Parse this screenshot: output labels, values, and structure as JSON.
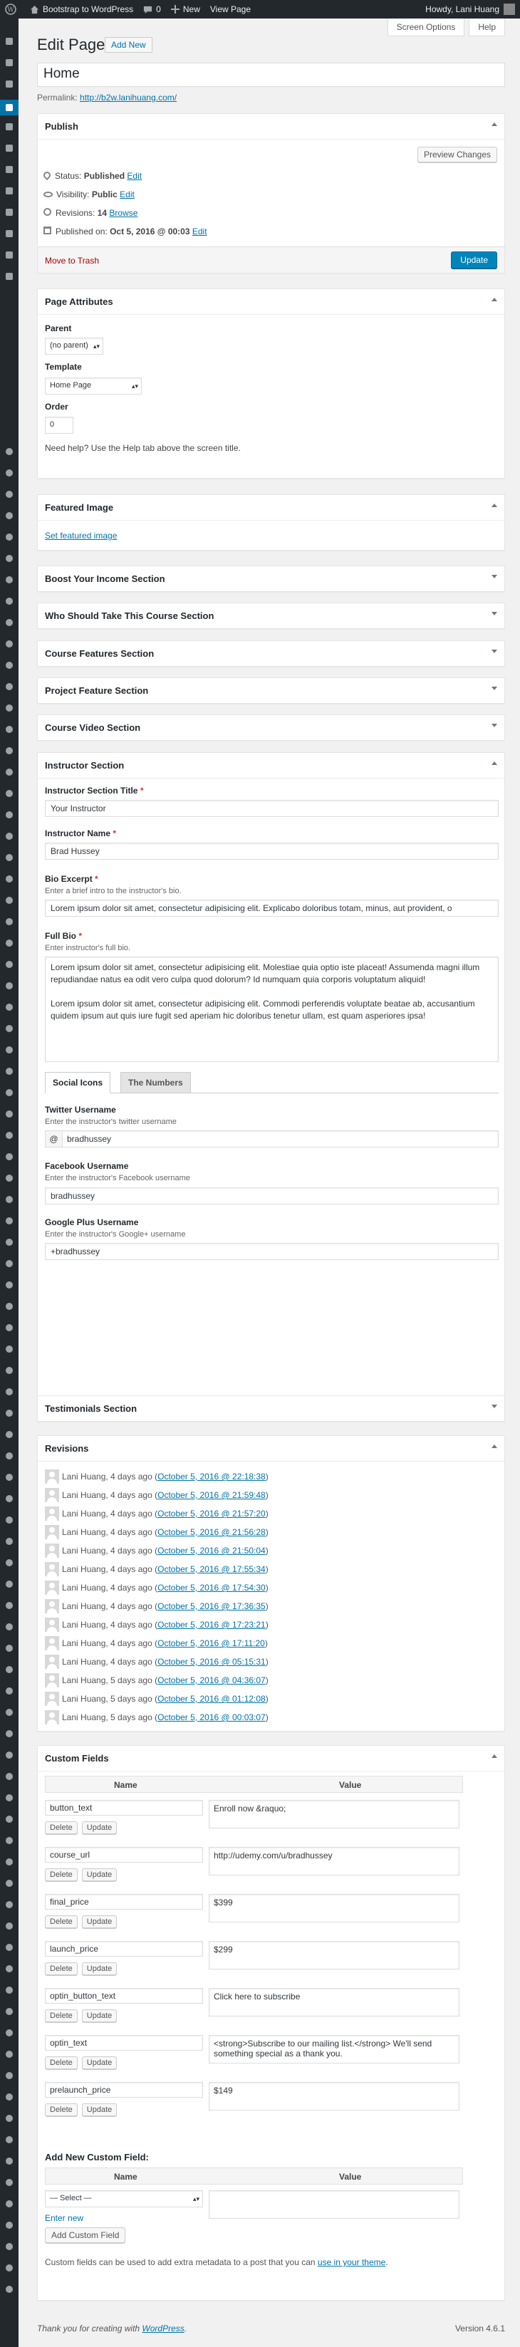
{
  "adminbar": {
    "site": "Bootstrap to WordPress",
    "comments": "0",
    "new": "New",
    "view": "View Page",
    "howdy": "Howdy, Lani Huang"
  },
  "header": {
    "screen_options": "Screen Options",
    "help": "Help",
    "title": "Edit Page",
    "add_new": "Add New"
  },
  "post": {
    "title": "Home",
    "permalink_label": "Permalink:",
    "permalink_url": "http://b2w.lanihuang.com/"
  },
  "publish": {
    "title": "Publish",
    "preview": "Preview Changes",
    "status_label": "Status:",
    "status": "Published",
    "visibility_label": "Visibility:",
    "visibility": "Public",
    "revisions_label": "Revisions:",
    "revisions": "14",
    "browse": "Browse",
    "published_label": "Published on:",
    "published": "Oct 5, 2016 @ 00:03",
    "edit": "Edit",
    "trash": "Move to Trash",
    "update": "Update"
  },
  "attributes": {
    "title": "Page Attributes",
    "parent_label": "Parent",
    "parent": "(no parent)",
    "template_label": "Template",
    "template": "Home Page",
    "order_label": "Order",
    "order": "0",
    "help": "Need help? Use the Help tab above the screen title."
  },
  "featured": {
    "title": "Featured Image",
    "link": "Set featured image"
  },
  "sections": {
    "income": "Boost Your Income Section",
    "who": "Who Should Take This Course Section",
    "features": "Course Features Section",
    "project": "Project Feature Section",
    "video": "Course Video Section",
    "instructor": "Instructor Section",
    "testimonials": "Testimonials Section"
  },
  "instructor": {
    "title_label": "Instructor Section Title",
    "title_value": "Your Instructor",
    "name_label": "Instructor Name",
    "name_value": "Brad Hussey",
    "excerpt_label": "Bio Excerpt",
    "excerpt_desc": "Enter a brief intro to the instructor's bio.",
    "excerpt_value": "Lorem ipsum dolor sit amet, consectetur adipisicing elit. Explicabo doloribus totam, minus, aut provident, o",
    "bio_label": "Full Bio",
    "bio_desc": "Enter instructor's full bio.",
    "bio_p1": "Lorem ipsum dolor sit amet, consectetur adipisicing elit. Molestiae quia optio iste placeat! Assumenda magni illum repudiandae natus ea odit vero culpa quod dolorum? Id numquam quia corporis voluptatum aliquid!",
    "bio_p2": "Lorem ipsum dolor sit amet, consectetur adipisicing elit. Commodi perferendis voluptate beatae ab, accusantium quidem ipsum aut quis iure fugit sed aperiam hic doloribus tenetur ullam, est quam asperiores ipsa!",
    "tab_social": "Social Icons",
    "tab_numbers": "The Numbers",
    "twitter_label": "Twitter Username",
    "twitter_desc": "Enter the instructor's twitter username",
    "twitter_prefix": "@",
    "twitter": "bradhussey",
    "facebook_label": "Facebook Username",
    "facebook_desc": "Enter the instructor's Facebook username",
    "facebook": "bradhussey",
    "google_label": "Google Plus Username",
    "google_desc": "Enter the instructor's Google+ username",
    "google": "+bradhussey"
  },
  "revisions": {
    "title": "Revisions",
    "items": [
      {
        "author": "Lani Huang, 4 days ago",
        "date": "October 5, 2016 @ 22:18:38"
      },
      {
        "author": "Lani Huang, 4 days ago",
        "date": "October 5, 2016 @ 21:59:48"
      },
      {
        "author": "Lani Huang, 4 days ago",
        "date": "October 5, 2016 @ 21:57:20"
      },
      {
        "author": "Lani Huang, 4 days ago",
        "date": "October 5, 2016 @ 21:56:28"
      },
      {
        "author": "Lani Huang, 4 days ago",
        "date": "October 5, 2016 @ 21:50:04"
      },
      {
        "author": "Lani Huang, 4 days ago",
        "date": "October 5, 2016 @ 17:55:34"
      },
      {
        "author": "Lani Huang, 4 days ago",
        "date": "October 5, 2016 @ 17:54:30"
      },
      {
        "author": "Lani Huang, 4 days ago",
        "date": "October 5, 2016 @ 17:36:35"
      },
      {
        "author": "Lani Huang, 4 days ago",
        "date": "October 5, 2016 @ 17:23:21"
      },
      {
        "author": "Lani Huang, 4 days ago",
        "date": "October 5, 2016 @ 17:11:20"
      },
      {
        "author": "Lani Huang, 4 days ago",
        "date": "October 5, 2016 @ 05:15:31"
      },
      {
        "author": "Lani Huang, 5 days ago",
        "date": "October 5, 2016 @ 04:36:07"
      },
      {
        "author": "Lani Huang, 5 days ago",
        "date": "October 5, 2016 @ 01:12:08"
      },
      {
        "author": "Lani Huang, 5 days ago",
        "date": "October 5, 2016 @ 00:03:07"
      }
    ]
  },
  "custom": {
    "title": "Custom Fields",
    "col_name": "Name",
    "col_value": "Value",
    "delete": "Delete",
    "update": "Update",
    "fields": [
      {
        "key": "button_text",
        "value": "Enroll now &raquo;"
      },
      {
        "key": "course_url",
        "value": "http://udemy.com/u/bradhussey"
      },
      {
        "key": "final_price",
        "value": "$399"
      },
      {
        "key": "launch_price",
        "value": "$299"
      },
      {
        "key": "optin_button_text",
        "value": "Click here to subscribe"
      },
      {
        "key": "optin_text",
        "value": "<strong>Subscribe to our mailing list.</strong> We'll send something special as a thank you."
      },
      {
        "key": "prelaunch_price",
        "value": "$149"
      }
    ],
    "add_label": "Add New Custom Field:",
    "select": "— Select —",
    "enter_new": "Enter new",
    "add_button": "Add Custom Field",
    "note_pre": "Custom fields can be used to add extra metadata to a post that you can ",
    "note_link": "use in your theme",
    "note_post": "."
  },
  "footer": {
    "thanks_pre": "Thank you for creating with ",
    "thanks_link": "WordPress",
    "thanks_post": ".",
    "version": "Version 4.6.1"
  }
}
